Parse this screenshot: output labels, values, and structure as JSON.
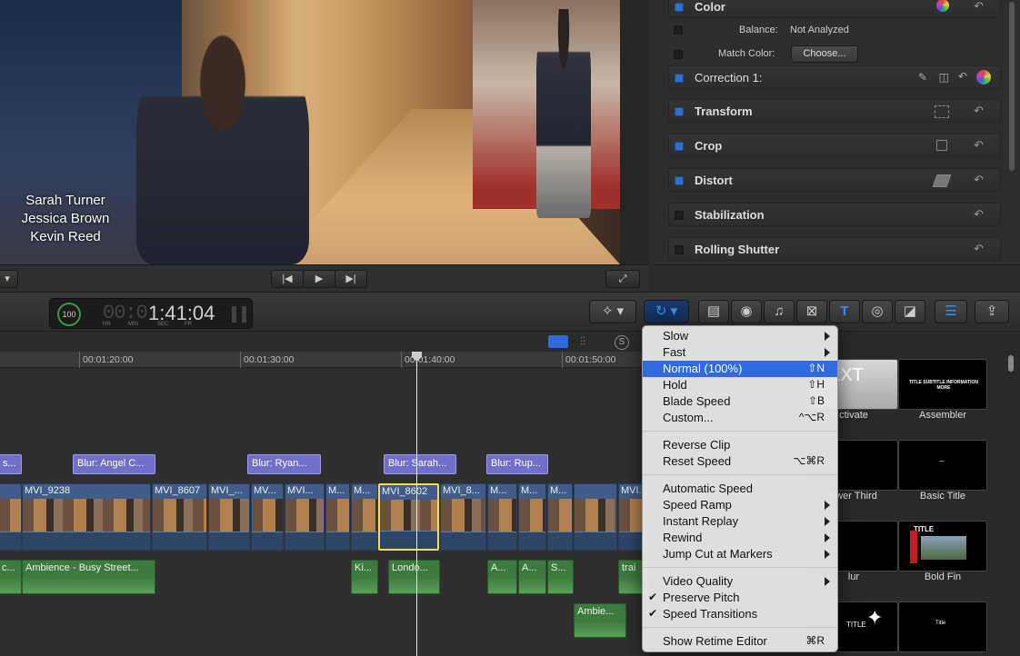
{
  "viewer": {
    "credits": [
      "Sarah Turner",
      "Jessica Brown",
      "Kevin Reed"
    ]
  },
  "inspector": {
    "color_label": "Color",
    "balance_label": "Balance:",
    "balance_value": "Not Analyzed",
    "match_color_label": "Match Color:",
    "choose_button": "Choose...",
    "correction_label": "Correction 1:",
    "sections": [
      "Transform",
      "Crop",
      "Distort",
      "Stabilization",
      "Rolling Shutter"
    ],
    "reset_glyph": "↶"
  },
  "dashboard": {
    "percent": "100",
    "timecode_dim": "00:0",
    "timecode": "1:41:04",
    "units": [
      "HR",
      "MIN",
      "SEC",
      "FR"
    ]
  },
  "timeline": {
    "ruler": [
      "00:01:20:00",
      "00:01:30:00",
      "00:01:40:00",
      "00:01:50:00"
    ],
    "title_clips": [
      "s...",
      "Blur: Angel C...",
      "Blur: Ryan...",
      "Blur: Sarah...",
      "Blur: Rup..."
    ],
    "video_clips": [
      "MVI_9238",
      "MVI_8607",
      "MVI_...",
      "MV...",
      "MVI...",
      "M...",
      "M...",
      "MVI_8602",
      "MVI_8...",
      "M...",
      "M...",
      "M...",
      "MVI..."
    ],
    "audio_clips": [
      "Ambience - Busy Street...",
      "Ki...",
      "Londo...",
      "A...",
      "A...",
      "S...",
      "trai",
      "Ambie...",
      "c..."
    ]
  },
  "browser": {
    "generators": [
      {
        "name": "ctivate",
        "thumb": "EXT"
      },
      {
        "name": "Assembler",
        "thumb": "TITLE SUBTITLE INFORMATION MORE"
      },
      {
        "name": "ower Third",
        "thumb": ""
      },
      {
        "name": "Basic Title",
        "thumb": "—"
      },
      {
        "name": "lur",
        "thumb": ""
      },
      {
        "name": "Bold Fin",
        "thumb": "TITLE"
      },
      {
        "name": "",
        "thumb": "TITLE"
      },
      {
        "name": "",
        "thumb": "Title"
      }
    ]
  },
  "retime_menu": {
    "items": [
      {
        "label": "Slow",
        "submenu": true
      },
      {
        "label": "Fast",
        "submenu": true
      },
      {
        "label": "Normal (100%)",
        "shortcut": "⇧N",
        "highlighted": true
      },
      {
        "label": "Hold",
        "shortcut": "⇧H"
      },
      {
        "label": "Blade Speed",
        "shortcut": "⇧B"
      },
      {
        "label": "Custom...",
        "shortcut": "^⌥R"
      },
      {
        "label": "Reverse Clip"
      },
      {
        "label": "Reset Speed",
        "shortcut": "⌥⌘R"
      },
      {
        "label": "Automatic Speed"
      },
      {
        "label": "Speed Ramp",
        "submenu": true
      },
      {
        "label": "Instant Replay",
        "submenu": true
      },
      {
        "label": "Rewind",
        "submenu": true
      },
      {
        "label": "Jump Cut at Markers",
        "submenu": true
      },
      {
        "label": "Video Quality",
        "submenu": true
      },
      {
        "label": "Preserve Pitch",
        "checked": true
      },
      {
        "label": "Speed Transitions",
        "checked": true
      },
      {
        "label": "Show Retime Editor",
        "shortcut": "⌘R"
      }
    ]
  },
  "colors": {
    "accent_blue": "#2f6ae0",
    "selection_yellow": "#f0e040",
    "title_clip": "#7070c8",
    "audio_clip": "#3d7a3d",
    "video_clip": "#3f5d88"
  }
}
